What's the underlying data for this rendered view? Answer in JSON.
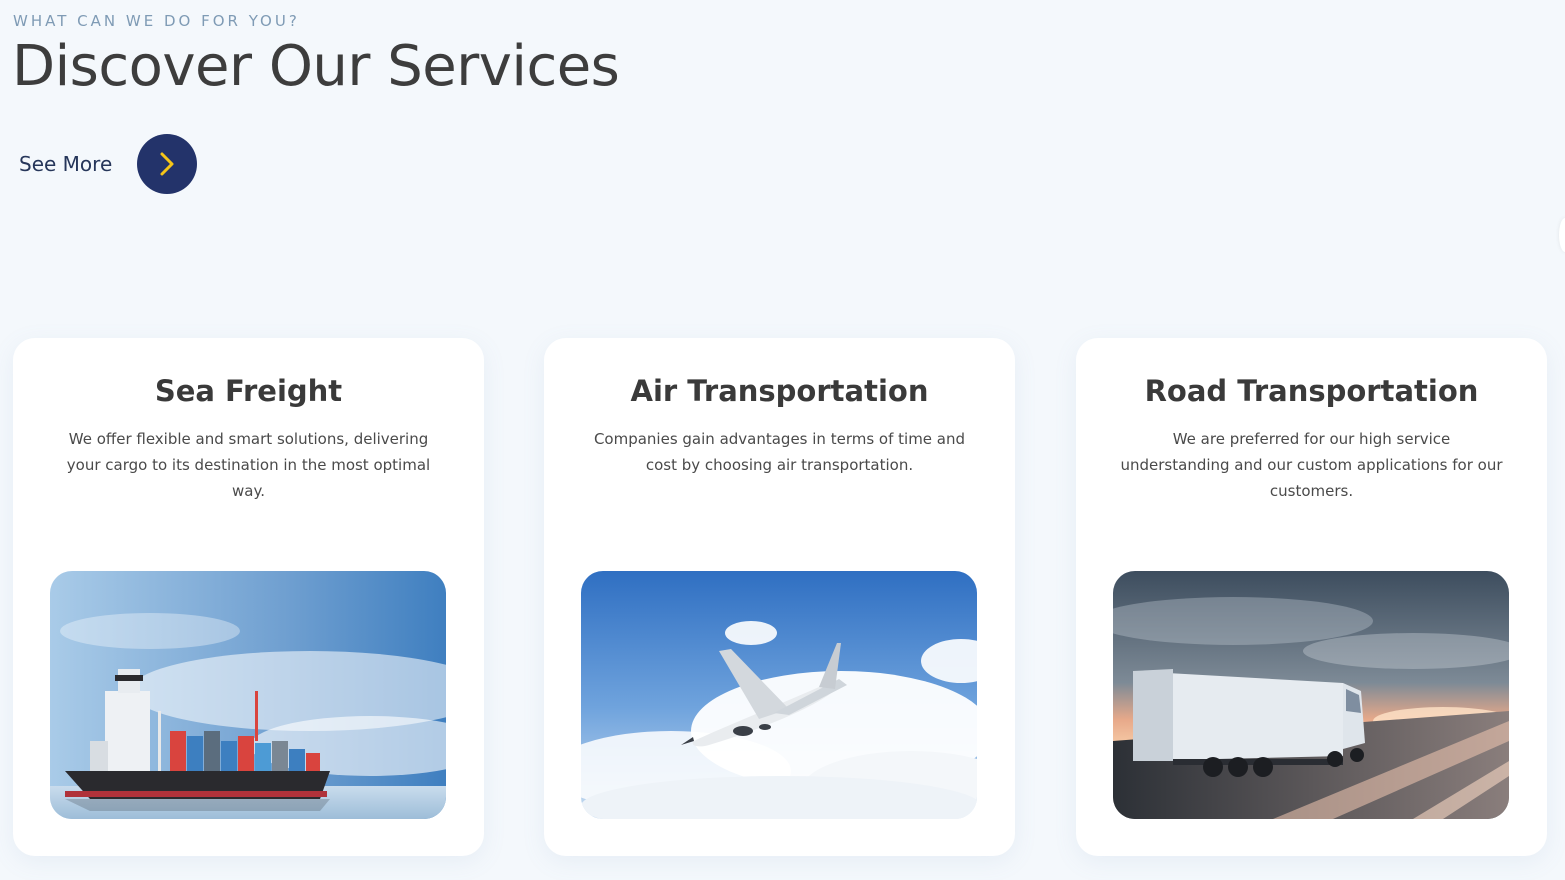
{
  "section": {
    "eyebrow": "WHAT CAN WE DO FOR YOU?",
    "title": "Discover Our Services",
    "see_more_label": "See More"
  },
  "services": [
    {
      "title": "Sea Freight",
      "description": "We offer flexible and smart solutions, delivering your cargo to its destination in the most optimal way.",
      "image": "container-ship-photo"
    },
    {
      "title": "Air Transportation",
      "description": "Companies gain advantages in terms of time and cost by choosing air transportation.",
      "image": "airplane-photo"
    },
    {
      "title": "Road Transportation",
      "description": "We are preferred for our high service understanding and our custom applications for our customers.",
      "image": "truck-photo"
    }
  ],
  "colors": {
    "background": "#f4f8fc",
    "accent": "#23336a",
    "arrow": "#f5c518",
    "eyebrow": "#7f9bb5"
  }
}
